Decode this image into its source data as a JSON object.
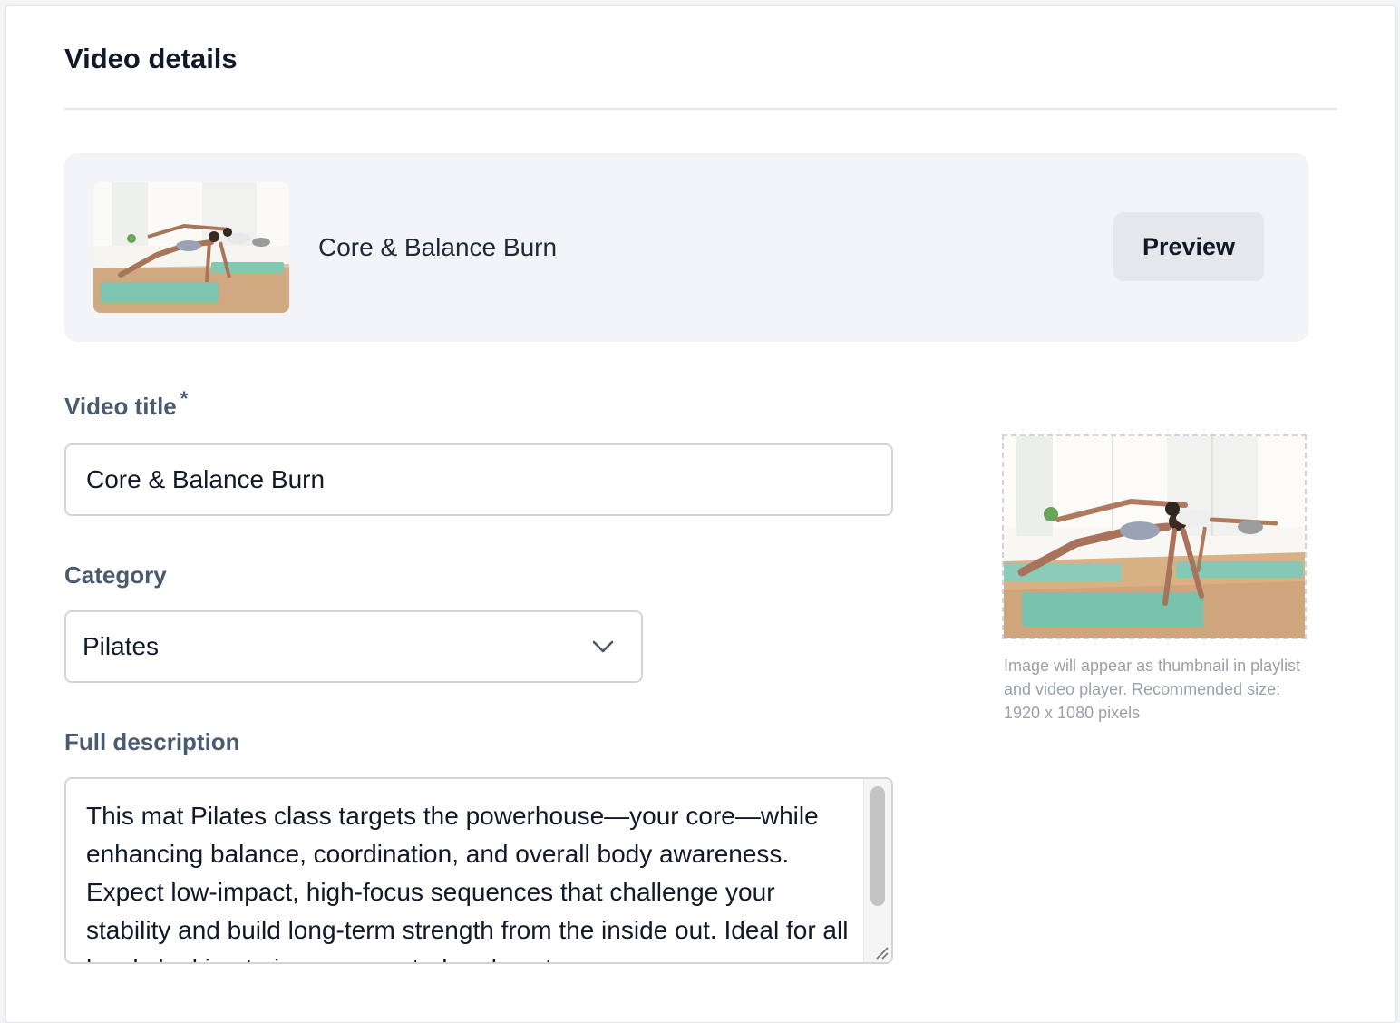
{
  "page": {
    "title": "Video details"
  },
  "summary": {
    "video_name": "Core & Balance Burn",
    "preview_label": "Preview"
  },
  "fields": {
    "title_label": "Video title",
    "title_required_mark": "*",
    "title_value": "Core & Balance Burn",
    "category_label": "Category",
    "category_value": "Pilates",
    "description_label": "Full description",
    "description_value": "This mat Pilates class targets the powerhouse—your core—while enhancing balance, coordination, and overall body awareness. Expect low-impact, high-focus sequences that challenge your stability and build long-term strength from the inside out. Ideal for all levels looking to improve control and posture."
  },
  "thumbnail": {
    "help_text": "Image will appear as thumbnail in playlist and video player. Recommended size: 1920 x 1080 pixels"
  },
  "icons": {
    "category_dropdown": "chevron-down-icon",
    "textarea_resize": "resize-grip-icon"
  },
  "colors": {
    "panel_background": "#f3f4f7",
    "button_background": "#e5e7eb",
    "label_color": "#4b5b6f",
    "border_color": "#d1d5db"
  }
}
